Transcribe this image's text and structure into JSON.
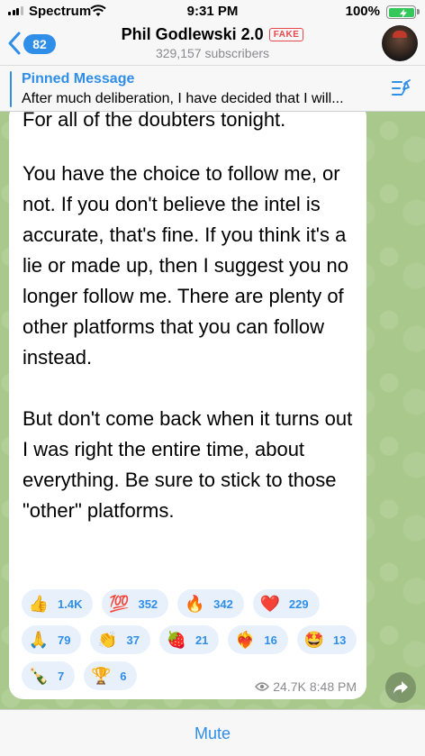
{
  "status_bar": {
    "carrier": "Spectrum",
    "time": "9:31 PM",
    "battery_percent": "100%",
    "battery_level": 1.0,
    "charging": true
  },
  "header": {
    "back_count": "82",
    "title": "Phil Godlewski 2.0",
    "badge": "FAKE",
    "subtitle": "329,157 subscribers",
    "back_icon": "chevron-left-icon",
    "avatar": "channel-avatar"
  },
  "pinned": {
    "title": "Pinned Message",
    "text": "After much deliberation, I have decided that I will...",
    "icon": "pinned-list-icon"
  },
  "message": {
    "cut_off_line": "For all of the doubters tonight.",
    "body": "You have the choice to follow me, or not.  If you don't believe the intel is accurate, that's fine. If you think it's a lie or made up, then I suggest you no longer follow me.  There are plenty of other platforms that you can follow instead.\n\nBut don't come back when it turns out I was right the entire time, about everything. Be sure to stick to those \"other\" platforms.",
    "views": "24.7K",
    "time": "8:48 PM",
    "reactions": [
      [
        {
          "emoji": "👍",
          "count": "1.4K"
        },
        {
          "emoji": "💯",
          "count": "352"
        },
        {
          "emoji": "🔥",
          "count": "342"
        },
        {
          "emoji": "❤️",
          "count": "229"
        }
      ],
      [
        {
          "emoji": "🙏",
          "count": "79"
        },
        {
          "emoji": "👏",
          "count": "37"
        },
        {
          "emoji": "🍓",
          "count": "21"
        },
        {
          "emoji": "❤️‍🔥",
          "count": "16"
        },
        {
          "emoji": "🤩",
          "count": "13"
        }
      ],
      [
        {
          "emoji": "🍾",
          "count": "7"
        },
        {
          "emoji": "🏆",
          "count": "6"
        }
      ]
    ]
  },
  "bottom": {
    "mute_label": "Mute"
  },
  "colors": {
    "accent": "#2f8ee8",
    "fake": "#e5484d",
    "chat_bg": "#a9c98c",
    "battery": "#34c759"
  }
}
